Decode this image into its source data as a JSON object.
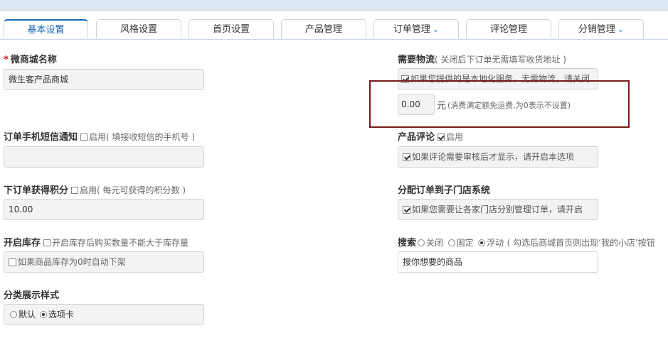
{
  "tabs": [
    {
      "label": "基本设置",
      "active": true,
      "dropdown": false
    },
    {
      "label": "风格设置",
      "active": false,
      "dropdown": false
    },
    {
      "label": "首页设置",
      "active": false,
      "dropdown": false
    },
    {
      "label": "产品管理",
      "active": false,
      "dropdown": false
    },
    {
      "label": "订单管理",
      "active": false,
      "dropdown": true
    },
    {
      "label": "评论管理",
      "active": false,
      "dropdown": false
    },
    {
      "label": "分销管理",
      "active": false,
      "dropdown": true
    }
  ],
  "left": {
    "shop_name": {
      "label": "微商城名称",
      "value": "微生客产品商城"
    },
    "sms": {
      "label": "订单手机短信通知",
      "enable": "启用",
      "hint": "( 填接收短信的手机号 )",
      "value": ""
    },
    "points": {
      "label": "下订单获得积分",
      "enable": "启用",
      "hint": "( 每元可获得的积分数 )",
      "value": "10.00"
    },
    "stock": {
      "label": "开启库存",
      "hint": "开启库存后购买数量不能大于库存量",
      "option": "如果商品库存为0时自动下架"
    },
    "category_style": {
      "label": "分类展示样式",
      "opt1": "默认",
      "opt2": "选项卡"
    }
  },
  "right": {
    "logistics": {
      "label": "需要物流",
      "hint": "( 关闭后下订单无需填写收货地址 )",
      "option": "如果您提供的是本地化服务，无需物流，请关闭",
      "price": "0.00",
      "unit": "元",
      "price_hint": "(消费满定额免运费,为0表示不设置)"
    },
    "review": {
      "label": "产品评论",
      "enable": "启用",
      "option": "如果评论需要审核后才显示，请开启本选项"
    },
    "branch": {
      "label": "分配订单到子门店系统",
      "option": "如果您需要让各家门店分别管理订单，请开启"
    },
    "search": {
      "label": "搜索",
      "opt1": "关闭",
      "opt2": "固定",
      "opt3": "浮动",
      "hint": "( 勾选后商城首页则出现‘我的小店’按钮",
      "value": "搜你想要的商品"
    }
  },
  "colors": {
    "accent": "#1a66b8",
    "annotation": "#7a1a1a"
  }
}
